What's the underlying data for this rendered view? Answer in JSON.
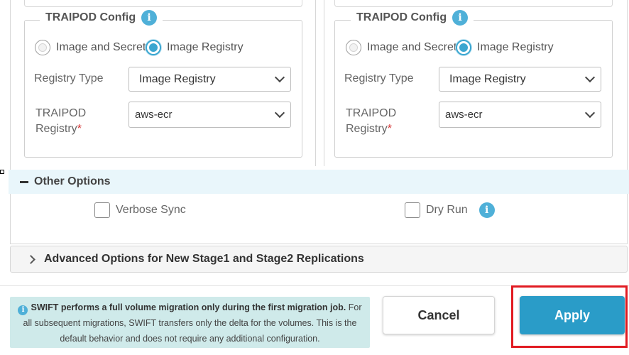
{
  "config_panels": [
    {
      "title": "TRAIPOD Config",
      "radio_options": [
        {
          "label": "Image and Secret",
          "selected": false
        },
        {
          "label": "Image Registry",
          "selected": true
        }
      ],
      "registry_type_label": "Registry Type",
      "registry_type_value": "Image Registry",
      "registry_label_line1": "TRAIPOD",
      "registry_label_line2": "Registry",
      "required_mark": "*",
      "registry_value": "aws-ecr"
    },
    {
      "title": "TRAIPOD Config",
      "radio_options": [
        {
          "label": "Image and Secret",
          "selected": false
        },
        {
          "label": "Image Registry",
          "selected": true
        }
      ],
      "registry_type_label": "Registry Type",
      "registry_type_value": "Image Registry",
      "registry_label_line1": "TRAIPOD",
      "registry_label_line2": "Registry",
      "required_mark": "*",
      "registry_value": "aws-ecr"
    }
  ],
  "other_options": {
    "title": "Other Options",
    "verbose_sync_label": "Verbose Sync",
    "dry_run_label": "Dry Run"
  },
  "advanced": {
    "title": "Advanced Options for New Stage1 and Stage2 Replications"
  },
  "footer": {
    "note_bold": "SWIFT performs a full volume migration only during the first migration job.",
    "note_rest": " For all subsequent migrations, SWIFT transfers only the delta for the volumes. This is the default behavior and does not require any additional configuration.",
    "cancel_label": "Cancel",
    "apply_label": "Apply"
  },
  "colors": {
    "accent": "#2a9cc8",
    "highlight": "#e11b22",
    "note_bg": "#cfeaea",
    "options_bg": "#e9f6fb"
  },
  "icons": {
    "info": "i",
    "minus": "minus-icon",
    "chevron": "chevron-right-icon"
  }
}
